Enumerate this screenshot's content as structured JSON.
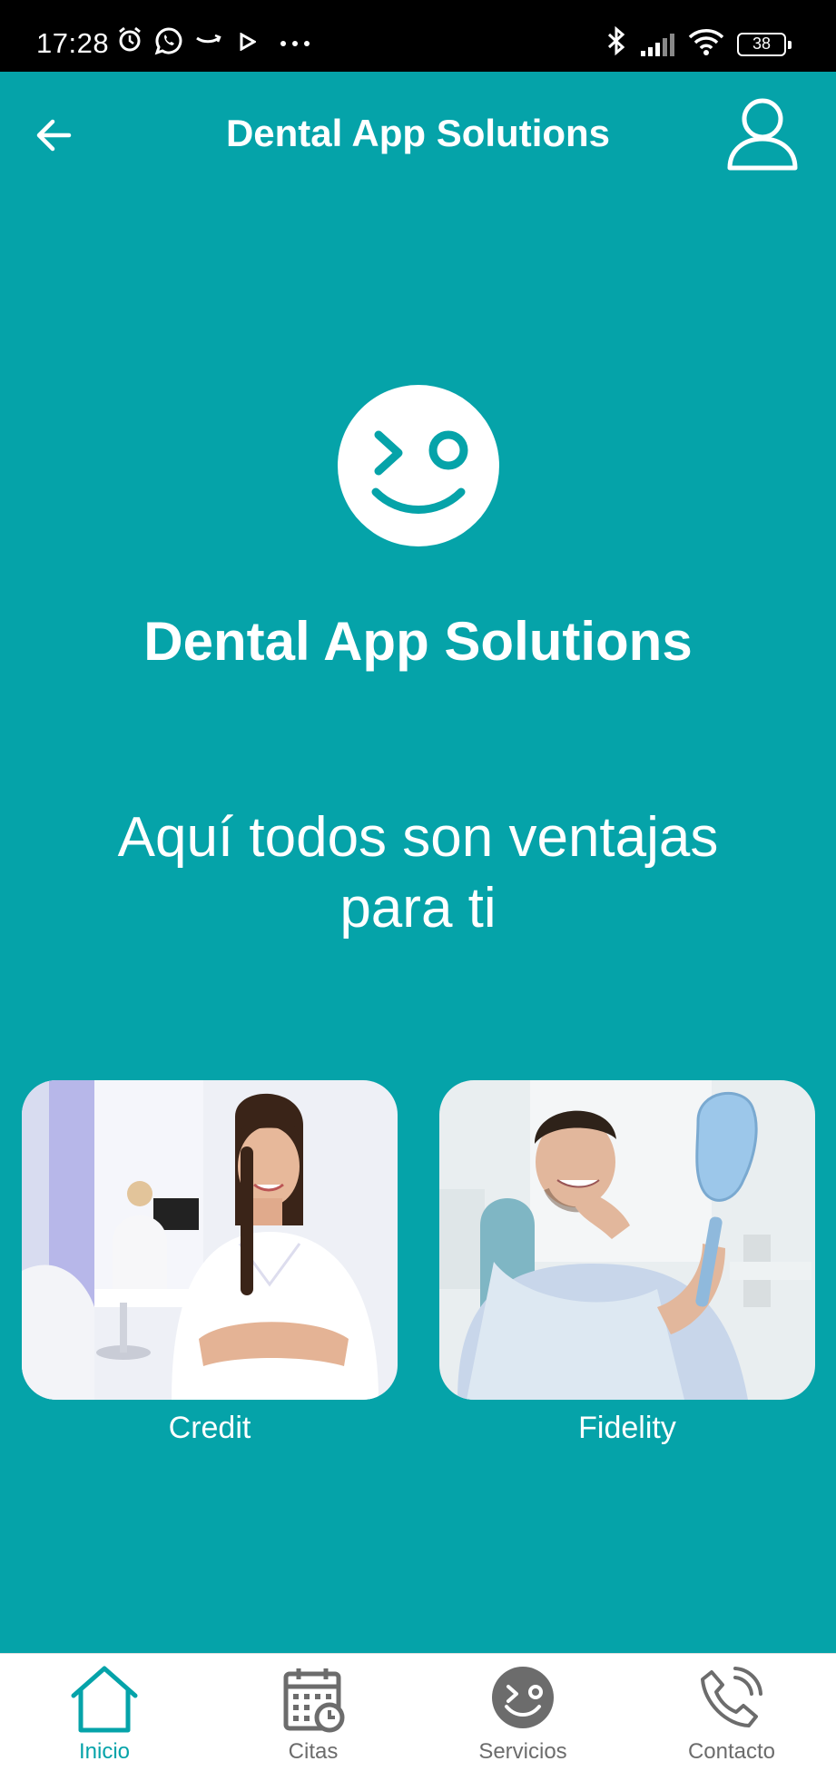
{
  "status_bar": {
    "time": "17:28",
    "battery": "38",
    "icons": [
      "alarm-icon",
      "whatsapp-icon",
      "amazon-icon",
      "play-icon",
      "more-dots-icon",
      "bluetooth-icon",
      "signal-icon",
      "wifi-icon",
      "battery-icon"
    ]
  },
  "app_bar": {
    "title": "Dental App Solutions",
    "back_icon": "arrow-left-icon",
    "profile_icon": "user-icon"
  },
  "hero": {
    "logo_icon": "wink-smile-logo",
    "brand_name": "Dental App Solutions",
    "tagline_line1": "Aquí todos son ventajas",
    "tagline_line2": "para ti"
  },
  "cards": [
    {
      "label": "Credit"
    },
    {
      "label": "Fidelity"
    }
  ],
  "bottom_nav": {
    "active": "Inicio",
    "items": [
      {
        "label": "Inicio",
        "icon": "home-icon"
      },
      {
        "label": "Citas",
        "icon": "calendar-clock-icon"
      },
      {
        "label": "Servicios",
        "icon": "wink-smile-icon"
      },
      {
        "label": "Contacto",
        "icon": "phone-icon"
      }
    ]
  },
  "colors": {
    "primary": "#05a3a9",
    "text_on_primary": "#ffffff",
    "nav_inactive": "#6c6c6c",
    "status_bar": "#000000"
  }
}
